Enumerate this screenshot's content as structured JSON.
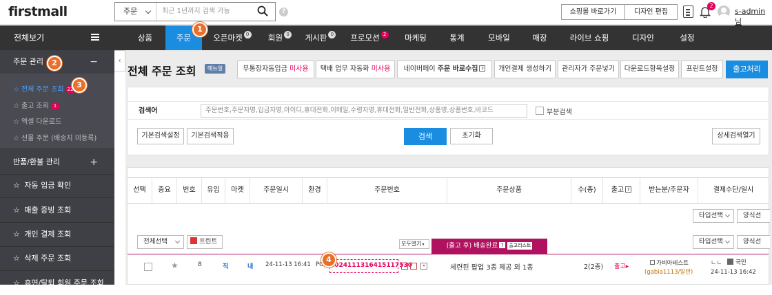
{
  "header": {
    "logo": "firstmall",
    "search": {
      "scope": "주문",
      "placeholder": "최근 1년까지 검색 가능"
    },
    "help": "?",
    "btn_store": "쇼핑몰 바로가기",
    "btn_design": "디자인 편집",
    "notif_count": "2",
    "user": "s-admin님"
  },
  "nav": {
    "all": "전체보기",
    "items": [
      {
        "label": "상품"
      },
      {
        "label": "주문",
        "active": true
      },
      {
        "label": "오픈마켓",
        "badge": "0"
      },
      {
        "label": "회원",
        "badge": "0"
      },
      {
        "label": "게시판",
        "badge": "0"
      },
      {
        "label": "프로모션",
        "badge": "2"
      },
      {
        "label": "마케팅"
      },
      {
        "label": "통계"
      },
      {
        "label": "모바일"
      },
      {
        "label": "매장"
      },
      {
        "label": "라이브 쇼핑"
      },
      {
        "label": "디자인"
      },
      {
        "label": "설정"
      }
    ]
  },
  "steps": [
    "1",
    "2",
    "3",
    "4"
  ],
  "sidebar": {
    "order_mgmt": "주문 관리",
    "links": [
      {
        "label": "전체 주문 조회",
        "badge": "22"
      },
      {
        "label": "출고 조회",
        "badge": "1"
      },
      {
        "label": "엑셀 다운로드"
      },
      {
        "label": "선물 주문 (배송지 미등록)"
      }
    ],
    "return_mgmt": "반품/환불 관리",
    "items": [
      "자동 입금 확인",
      "매출 증빙 조회",
      "개인 결제 조회",
      "삭제 주문 조회",
      "휴면/탈퇴 회원 주문 조회"
    ]
  },
  "page": {
    "title": "전체 주문 조회",
    "manual": "메뉴얼",
    "actions": [
      {
        "label": "무통장자동입금",
        "status": "미사용"
      },
      {
        "label": "택배 업무 자동화",
        "status": "미사용"
      },
      {
        "label": "네이버페이",
        "bold": "주문 바로수집"
      },
      {
        "label": "개인결제 생성하기"
      },
      {
        "label": "관리자가 주문넣기"
      },
      {
        "label": "다운로드항목설정"
      },
      {
        "label": "프린트설정"
      }
    ],
    "ship_btn": "출고처리"
  },
  "search_panel": {
    "keyword_label": "검색어",
    "keyword_placeholder": "주문번호,주문자명,입금자명,아이디,휴대전화,이메일,수령자명,휴대전화,일반전화,상품명,상품번호,바코드",
    "partial": "부분검색",
    "basic_setting": "기본검색설정",
    "basic_apply": "기본검색적용",
    "search_btn": "검색",
    "reset_btn": "초기화",
    "detail_btn": "상세검색열기"
  },
  "table": {
    "headers": [
      "선택",
      "중요",
      "번호",
      "유입",
      "마켓",
      "주문일시",
      "환경",
      "주문번호",
      "주문상품",
      "수(종)",
      "출고",
      "받는분/주문자",
      "결제수단/일시"
    ],
    "type_select": "타입선택",
    "pay_select": "양식선",
    "select_all": "전체선택",
    "print": "프린트",
    "expand_all": "모두열기",
    "section": "(출고 후) 배송완료",
    "section_tag": "출고리스트",
    "row": {
      "num": "8",
      "inflow": "직",
      "market": "내",
      "date": "24-11-13 16:41",
      "env": "PC",
      "order_no": "2024111316415117530",
      "product": "세련된 팝업 3종 제공 외 1종",
      "qty": "2(2종)",
      "ship": "출고",
      "receiver": "가비아테스트",
      "orderer": "(gabia1113/일반)",
      "pay_method": "국민",
      "pay_time": "24-11-13 16:42"
    }
  },
  "colors": {
    "accent": "#1b8de0",
    "pink": "#e5005a",
    "step": "#e8702a",
    "sidebar": "#3f3f46"
  }
}
